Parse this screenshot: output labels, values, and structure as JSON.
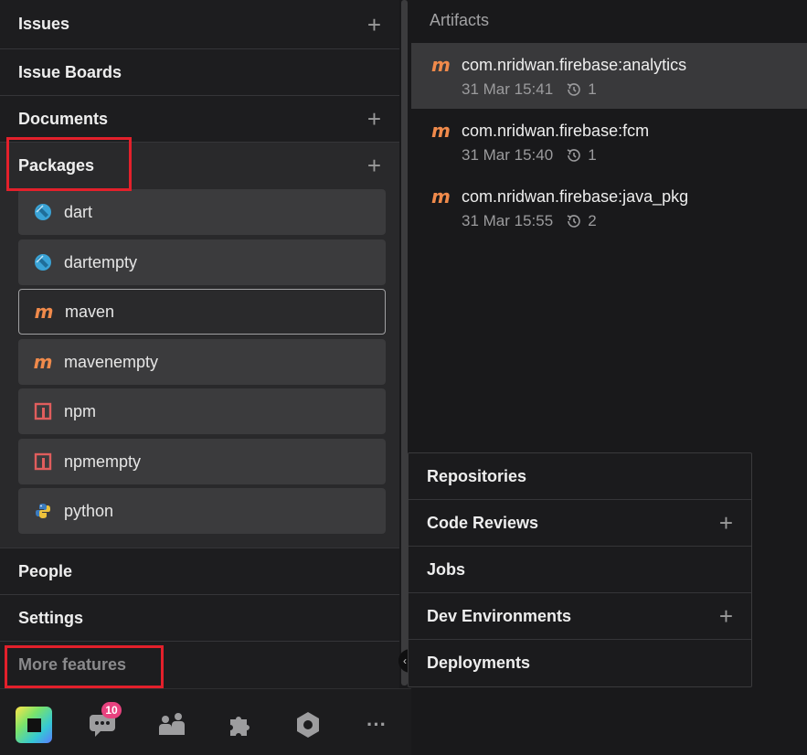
{
  "sidebar": {
    "issues": {
      "label": "Issues",
      "add": "+"
    },
    "issue_boards": {
      "label": "Issue Boards"
    },
    "documents": {
      "label": "Documents",
      "add": "+"
    },
    "packages": {
      "label": "Packages",
      "add": "+",
      "items": [
        {
          "label": "dart",
          "icon": "dart-icon"
        },
        {
          "label": "dartempty",
          "icon": "dart-icon"
        },
        {
          "label": "maven",
          "icon": "maven-icon",
          "selected": true
        },
        {
          "label": "mavenempty",
          "icon": "maven-icon"
        },
        {
          "label": "npm",
          "icon": "npm-icon"
        },
        {
          "label": "npmempty",
          "icon": "npm-icon"
        },
        {
          "label": "python",
          "icon": "python-icon"
        }
      ]
    },
    "people": {
      "label": "People"
    },
    "settings": {
      "label": "Settings"
    },
    "more_features": {
      "label": "More features"
    }
  },
  "bottombar": {
    "chat_badge": "10",
    "items": [
      "app-logo",
      "chat-icon",
      "team-icon",
      "extensions-icon",
      "settings-hex-icon",
      "more-icon"
    ]
  },
  "artifacts": {
    "title": "Artifacts",
    "items": [
      {
        "name": "com.nridwan.firebase:analytics",
        "date": "31 Mar 15:41",
        "versions": "1",
        "active": true
      },
      {
        "name": "com.nridwan.firebase:fcm",
        "date": "31 Mar 15:40",
        "versions": "1"
      },
      {
        "name": "com.nridwan.firebase:java_pkg",
        "date": "31 Mar 15:55",
        "versions": "2"
      }
    ]
  },
  "popup": {
    "items": [
      {
        "label": "Repositories",
        "add": ""
      },
      {
        "label": "Code Reviews",
        "add": "+"
      },
      {
        "label": "Jobs",
        "add": ""
      },
      {
        "label": "Dev Environments",
        "add": "+"
      },
      {
        "label": "Deployments",
        "add": ""
      }
    ]
  },
  "glyphs": {
    "maven": "m",
    "more": "···",
    "collapse": "‹"
  },
  "colors": {
    "highlight": "#e3202b",
    "maven": "#f08a4b",
    "badge": "#e8427f"
  }
}
